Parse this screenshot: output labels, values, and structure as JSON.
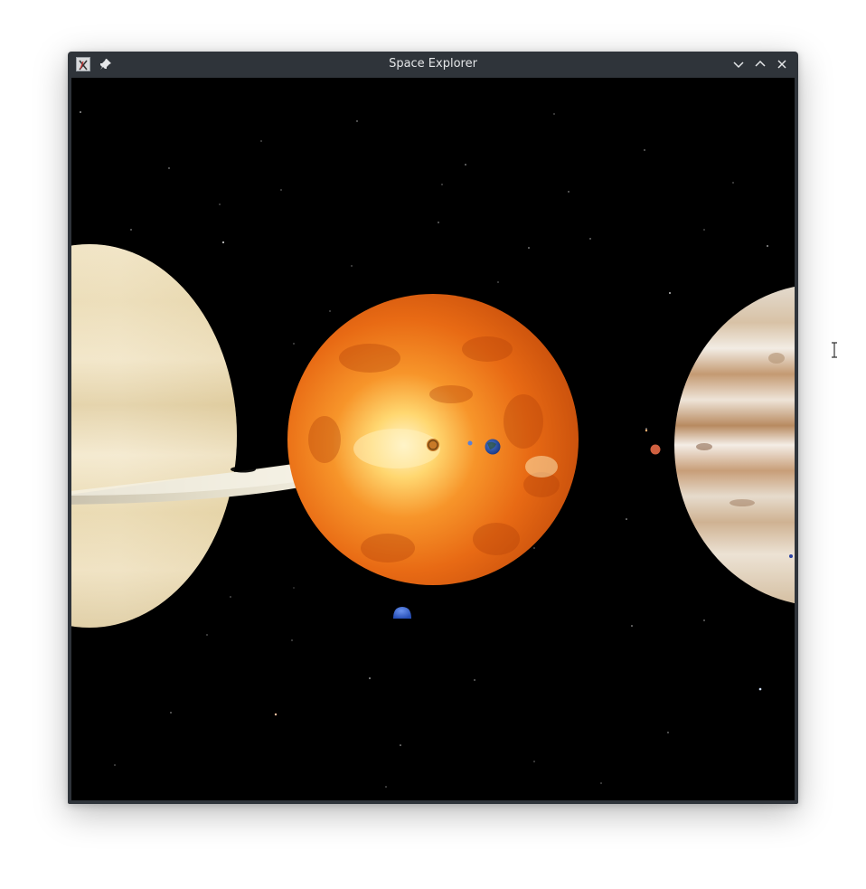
{
  "window": {
    "title": "Space Explorer",
    "app_icon": "x-app-icon",
    "pin_icon": "pin-icon",
    "controls": [
      "minimize-icon",
      "maximize-icon",
      "close-icon"
    ]
  },
  "scene": {
    "background": "#000000",
    "bodies": [
      "sun",
      "saturn",
      "jupiter",
      "mercury",
      "earth",
      "venus",
      "mars",
      "neptune"
    ],
    "colors": {
      "sun": "#f07a1a",
      "saturn": "#e8d8b0",
      "jupiter": "#d8c0a0",
      "earth": "#2a50a8",
      "mars": "#d86040",
      "neptune": "#3a68d0"
    }
  }
}
